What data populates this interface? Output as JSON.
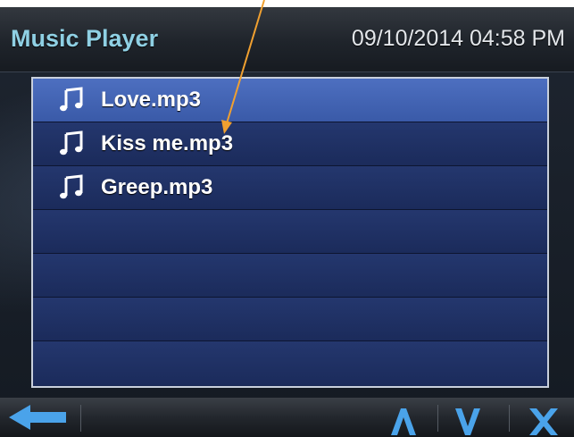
{
  "header": {
    "title": "Music Player",
    "datetime": "09/10/2014 04:58 PM"
  },
  "file_list": {
    "items": [
      {
        "label": "Love.mp3",
        "icon": "music-note-icon",
        "selected": true
      },
      {
        "label": "Kiss me.mp3",
        "icon": "music-note-icon",
        "selected": false
      },
      {
        "label": "Greep.mp3",
        "icon": "music-note-icon",
        "selected": false
      },
      {
        "label": "",
        "icon": "",
        "selected": false
      },
      {
        "label": "",
        "icon": "",
        "selected": false
      },
      {
        "label": "",
        "icon": "",
        "selected": false
      },
      {
        "label": "",
        "icon": "",
        "selected": false
      }
    ]
  },
  "toolbar": {
    "back_icon": "back-arrow-icon",
    "up_icon": "up-icon",
    "down_icon": "down-icon",
    "close_icon": "close-icon"
  },
  "colors": {
    "title": "#8fd0e4",
    "row_selected": "#4d6fc0",
    "row": "#24376e",
    "button_accent": "#4aa3ea",
    "annotation_arrow": "#f0a030"
  }
}
